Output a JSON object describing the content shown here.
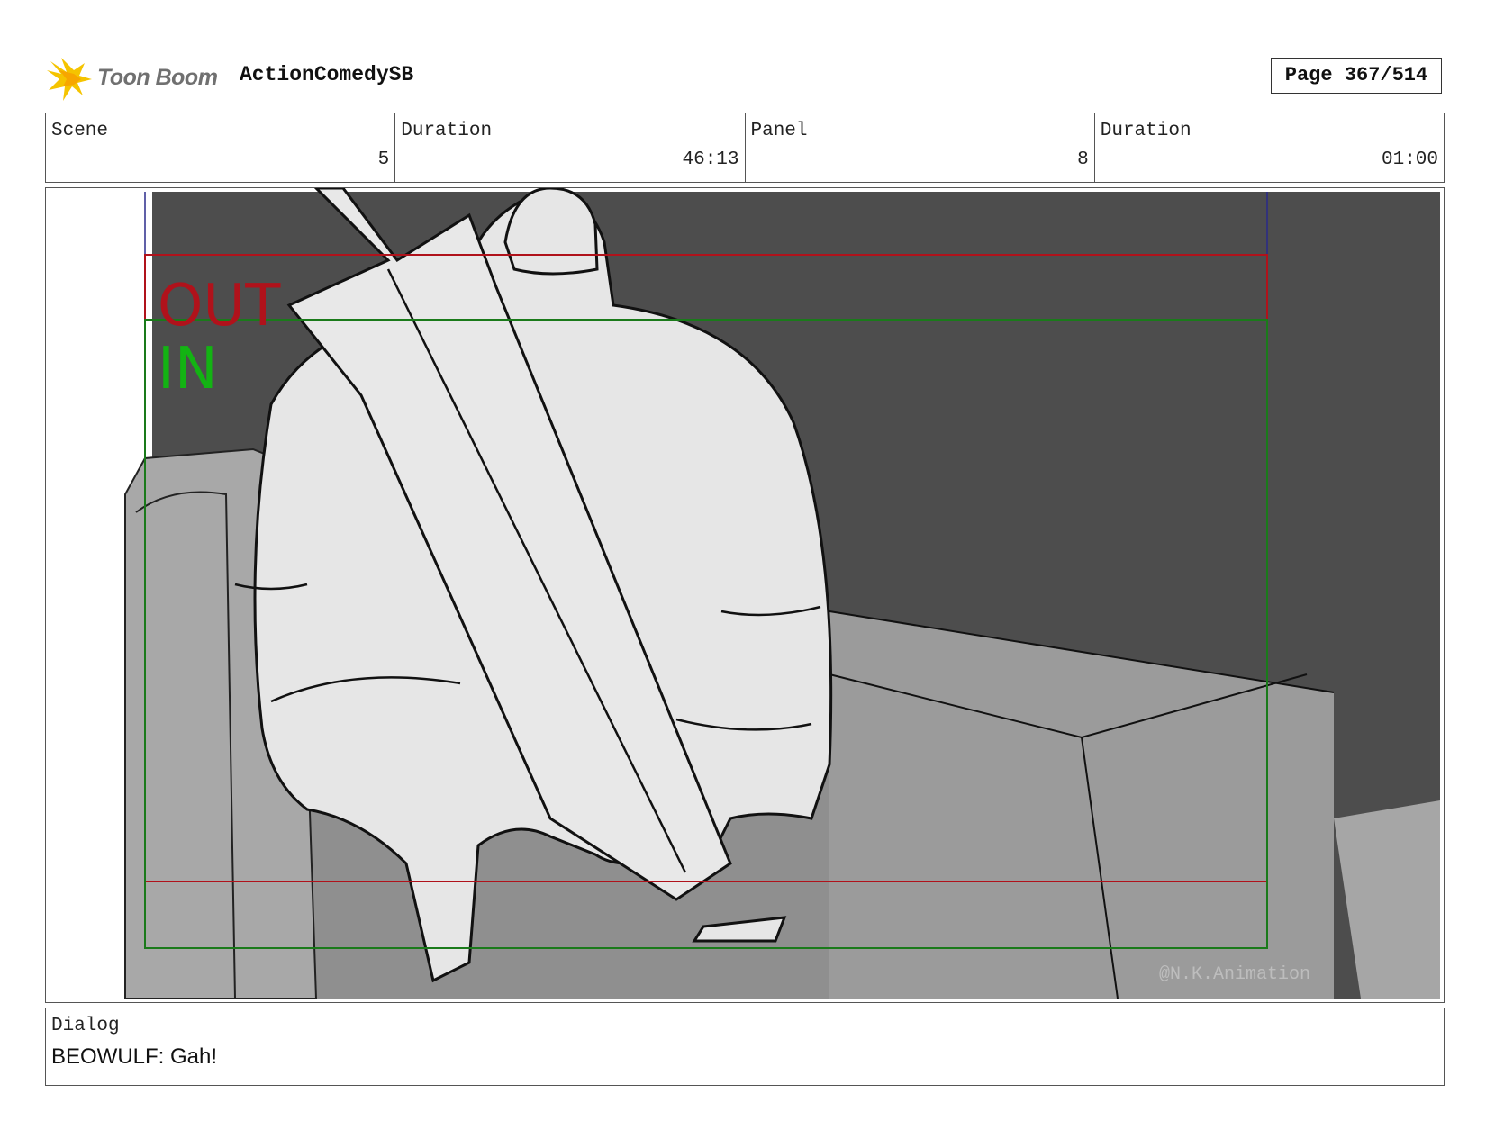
{
  "header": {
    "brand": "Toon Boom",
    "project": "ActionComedySB",
    "page": "Page 367/514"
  },
  "info": {
    "scene_label": "Scene",
    "scene_value": "5",
    "scene_duration_label": "Duration",
    "scene_duration_value": "46:13",
    "panel_label": "Panel",
    "panel_value": "8",
    "panel_duration_label": "Duration",
    "panel_duration_value": "01:00"
  },
  "panel": {
    "out_label": "OUT",
    "in_label": "IN",
    "watermark": "@N.K.Animation",
    "colors": {
      "out_frame": "#b0121b",
      "in_frame": "#1a7a1a",
      "background_dark": "#4d4d4d",
      "floor": "#9b9b9b",
      "figure": "#e6e6e6"
    }
  },
  "dialog": {
    "label": "Dialog",
    "text": "BEOWULF: Gah!"
  }
}
